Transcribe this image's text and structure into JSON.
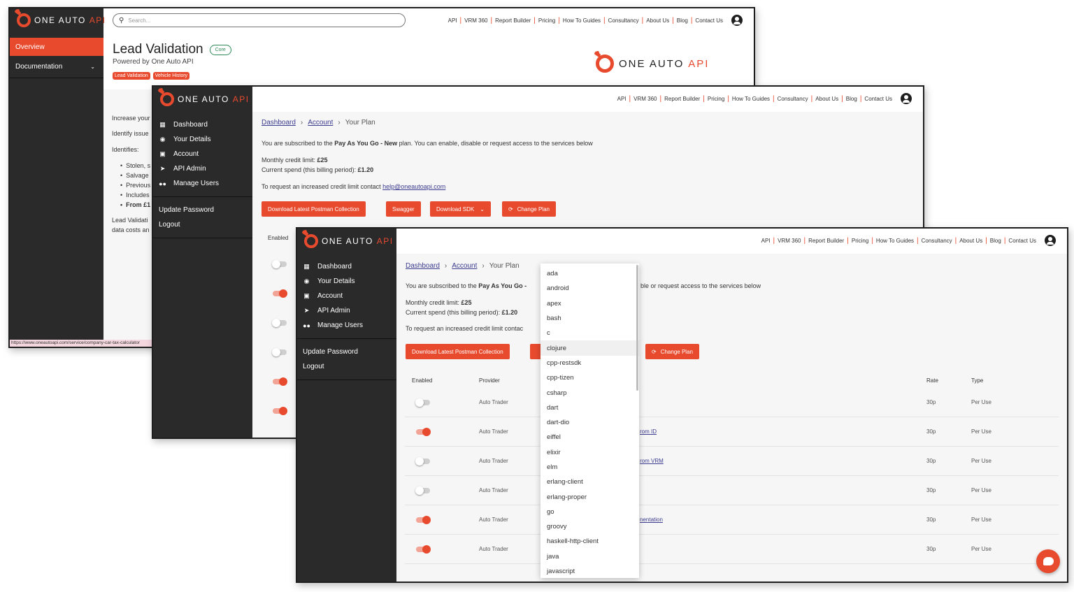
{
  "brand": {
    "word": "ONE AUTO",
    "accent": "API"
  },
  "colors": {
    "accent": "#e84a2e",
    "sidebar": "#2a2a2a"
  },
  "nav_links": [
    "API",
    "VRM 360",
    "Report Builder",
    "Pricing",
    "How To Guides",
    "Consultancy",
    "About Us",
    "Blog",
    "Contact Us"
  ],
  "win1": {
    "search_placeholder": "Search...",
    "sidebar": {
      "overview": "Overview",
      "documentation": "Documentation"
    },
    "title": "Lead Validation",
    "badge": "Core",
    "subtitle": "Powered by One Auto API",
    "tags": [
      "Lead Validation",
      "Vehicle History"
    ],
    "body": {
      "l1": "Increase your",
      "l2": "Identify issue",
      "l3": "Identifies:",
      "bullets": [
        "Stolen, s",
        "Salvage",
        "Previous",
        "Includes",
        "From £1"
      ],
      "l4": "Lead Validati",
      "l5": "data costs an"
    },
    "status_url": "https://www.oneautoapi.com/service/company-car-tax-calculator"
  },
  "menu": {
    "dashboard": "Dashboard",
    "details": "Your Details",
    "account": "Account",
    "api_admin": "API Admin",
    "manage_users": "Manage Users",
    "update_password": "Update Password",
    "logout": "Logout"
  },
  "plan": {
    "crumb_dashboard": "Dashboard",
    "crumb_account": "Account",
    "crumb_current": "Your Plan",
    "sub_pre": "You are subscribed to the ",
    "sub_plan": "Pay As You Go - New",
    "sub_post": " plan. You can enable, disable or request access to the services below",
    "limit_label": "Monthly credit limit: ",
    "limit_value": "£25",
    "spend_label": "Current spend (this billing period): ",
    "spend_value": "£1.20",
    "request_text": "To request an increased credit limit contact ",
    "email": "help@oneautoapi.com",
    "buttons": {
      "postman": "Download Latest Postman Collection",
      "swagger": "Swagger",
      "sdk": "Download SDK",
      "change": "Change Plan"
    }
  },
  "win3": {
    "sub_pre": "You are subscribed to the ",
    "sub_plan": "Pay As You Go -",
    "sub_tail": "ble or request access to the services below",
    "request_text": "To request an increased credit limit contac",
    "table_headers": {
      "enabled": "Enabled",
      "provider": "Provider",
      "rate": "Rate",
      "type": "Type"
    },
    "rows": [
      {
        "enabled": false,
        "provider": "Auto Trader",
        "link": "",
        "rate": "30p",
        "type": "Per Use"
      },
      {
        "enabled": true,
        "provider": "Auto Trader",
        "link": "rom ID",
        "rate": "30p",
        "type": "Per Use"
      },
      {
        "enabled": false,
        "provider": "Auto Trader",
        "link": "rom VRM",
        "rate": "30p",
        "type": "Per Use"
      },
      {
        "enabled": false,
        "provider": "Auto Trader",
        "link": "",
        "rate": "30p",
        "type": "Per Use"
      },
      {
        "enabled": true,
        "provider": "Auto Trader",
        "link": "nentation",
        "rate": "30p",
        "type": "Per Use"
      },
      {
        "enabled": true,
        "provider": "Auto Trader",
        "link": "",
        "rate": "30p",
        "type": "Per Use"
      }
    ],
    "sdk_options": [
      "ada",
      "android",
      "apex",
      "bash",
      "c",
      "clojure",
      "cpp-restsdk",
      "cpp-tizen",
      "csharp",
      "dart",
      "dart-dio",
      "eiffel",
      "elixir",
      "elm",
      "erlang-client",
      "erlang-proper",
      "go",
      "groovy",
      "haskell-http-client",
      "java",
      "javascript"
    ]
  }
}
